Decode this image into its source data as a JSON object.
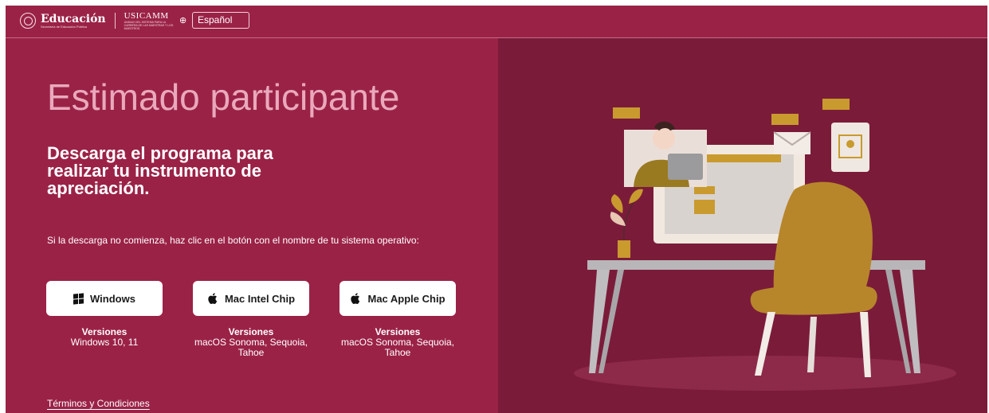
{
  "header": {
    "logo_text": "Educación",
    "logo_subtext": "Secretaría de Educación Pública",
    "logo_partner": "USICAMM",
    "logo_partner_subtext": "UNIDAD DEL SISTEMA PARA LA CARRERA DE LAS MAESTRAS Y LOS MAESTROS",
    "language": "Español"
  },
  "main": {
    "title": "Estimado participante",
    "subtitle": "Descarga el programa para realizar tu instrumento de apreciación.",
    "instructions": "Si la descarga no comienza, haz clic en el botón con el nombre de tu sistema operativo:",
    "downloads": [
      {
        "label": "Windows",
        "icon": "windows-icon",
        "versions_title": "Versiones",
        "versions": "Windows 10, 11"
      },
      {
        "label": "Mac Intel Chip",
        "icon": "apple-icon",
        "versions_title": "Versiones",
        "versions": "macOS Sonoma, Sequoia, Tahoe"
      },
      {
        "label": "Mac Apple Chip",
        "icon": "apple-icon",
        "versions_title": "Versiones",
        "versions": "macOS Sonoma, Sequoia, Tahoe"
      }
    ],
    "terms_link": "Términos y Condiciones"
  },
  "colors": {
    "brand": "#9b2247",
    "panel": "#7b1b3a",
    "title": "#e9a9bc",
    "accent": "#c99a2e"
  }
}
